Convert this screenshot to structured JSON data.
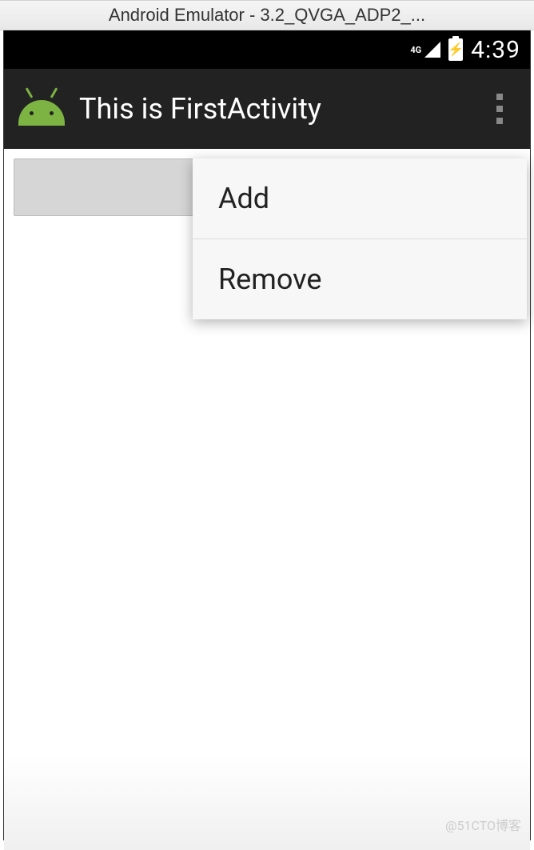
{
  "window": {
    "title": "Android Emulator - 3.2_QVGA_ADP2_..."
  },
  "status_bar": {
    "network": "4G",
    "time": "4:39"
  },
  "app_bar": {
    "title": "This is FirstActivity"
  },
  "popup_menu": {
    "items": [
      {
        "label": "Add"
      },
      {
        "label": "Remove"
      }
    ]
  },
  "watermark": "@51CTO博客"
}
